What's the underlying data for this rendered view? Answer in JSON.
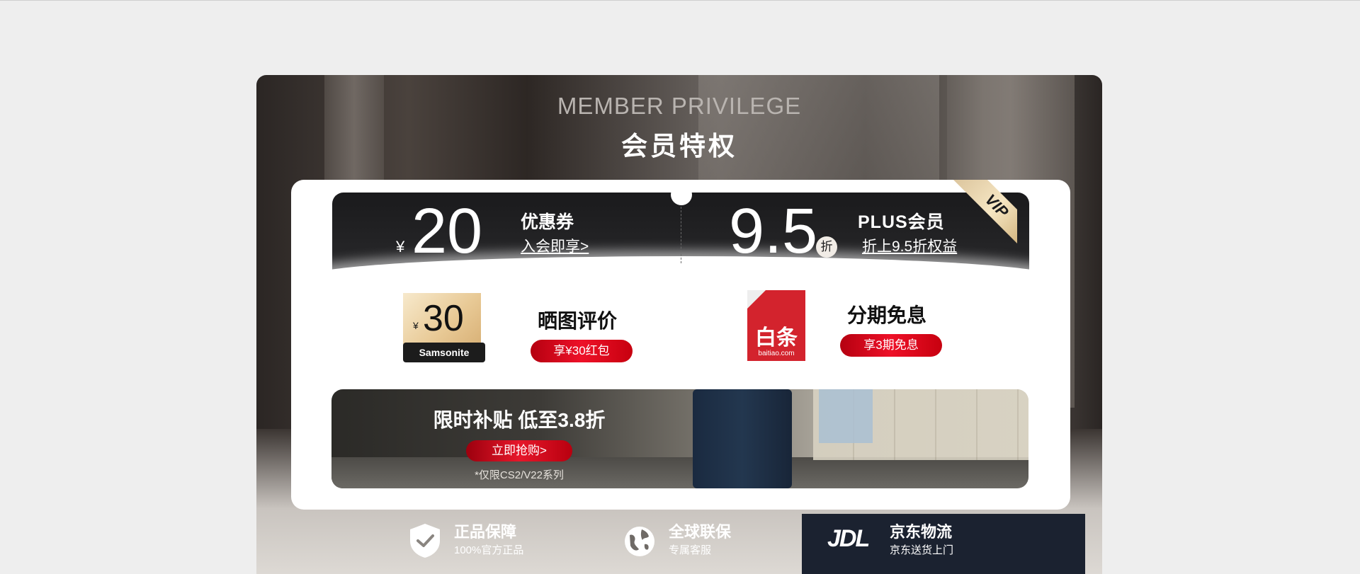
{
  "header": {
    "title_en": "MEMBER PRIVILEGE",
    "title_cn": "会员特权"
  },
  "coupon": {
    "currency": "¥",
    "amount": "20",
    "title": "优惠券",
    "link": "入会即享>"
  },
  "plus": {
    "amount": "9.5",
    "unit": "折",
    "title": "PLUS会员",
    "link": "折上9.5折权益",
    "corner_badge": "VIP"
  },
  "review": {
    "coupon_currency": "¥",
    "coupon_amount": "30",
    "coupon_brand": "Samsonite",
    "title": "晒图评价",
    "button": "享¥30红包"
  },
  "installment": {
    "logo_text": "白条",
    "logo_sub": "baitiao.com",
    "title": "分期免息",
    "button": "享3期免息"
  },
  "promo": {
    "title": "限时补贴 低至3.8折",
    "button": "立即抢购>",
    "note": "*仅限CS2/V22系列"
  },
  "guarantees": [
    {
      "icon": "shield-check-icon",
      "title": "正品保障",
      "subtitle": "100%官方正品"
    },
    {
      "icon": "globe-icon",
      "title": "全球联保",
      "subtitle": "专属客服"
    },
    {
      "icon": "jdl-logo",
      "logo_text": "JDL",
      "title": "京东物流",
      "subtitle": "京东送货上门"
    }
  ],
  "colors": {
    "page_bg": "#eeeeee",
    "accent_red": "#e6172a",
    "gold": "#e8c995",
    "dark_band": "#1a1a1c"
  }
}
